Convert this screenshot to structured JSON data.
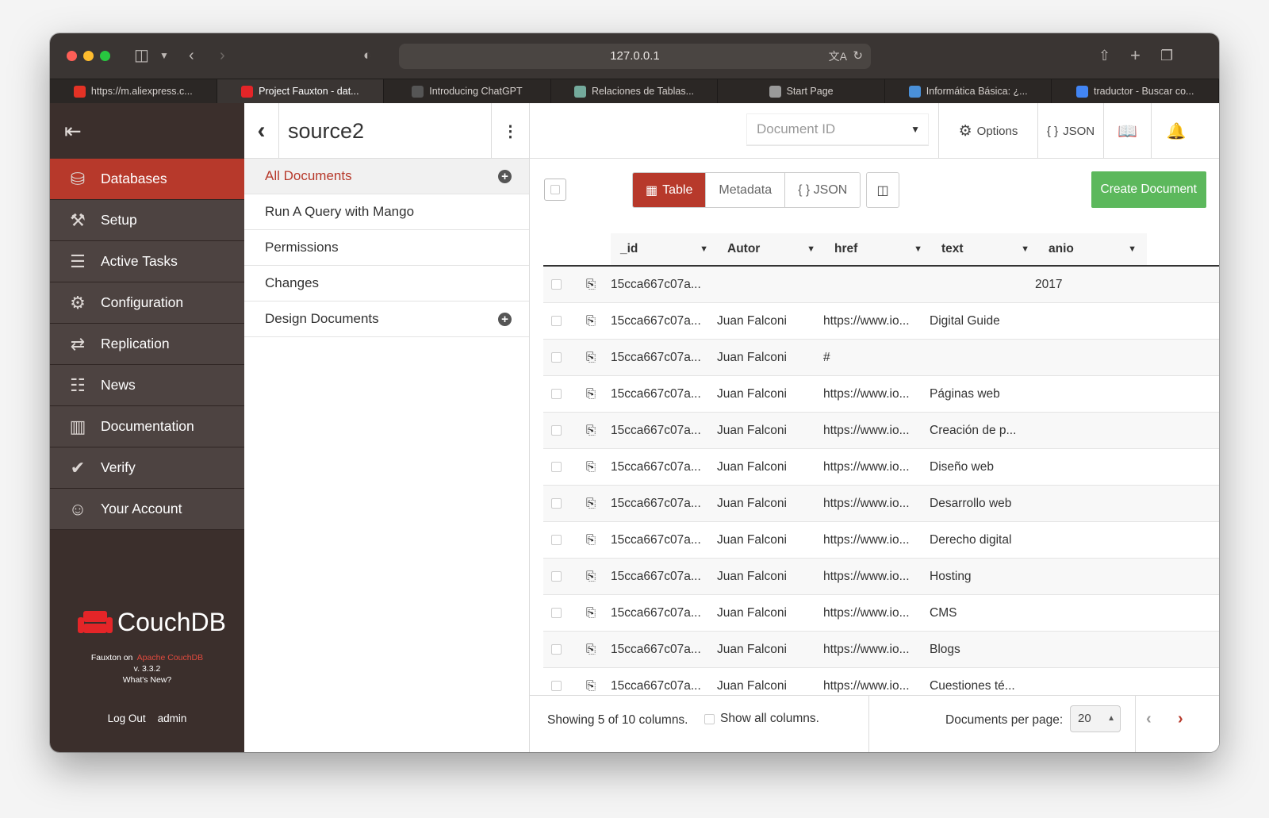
{
  "browser": {
    "url": "127.0.0.1",
    "tabs": [
      {
        "label": "https://m.aliexpress.c...",
        "favicon_color": "#e43225"
      },
      {
        "label": "Project Fauxton - dat...",
        "favicon_color": "#e42528",
        "active": true
      },
      {
        "label": "Introducing ChatGPT",
        "favicon_color": "#555555"
      },
      {
        "label": "Relaciones de Tablas...",
        "favicon_color": "#74aa9c"
      },
      {
        "label": "Start Page",
        "favicon_color": "#9a9a9a"
      },
      {
        "label": "Informática Básica: ¿...",
        "favicon_color": "#4a90d9"
      },
      {
        "label": "traductor - Buscar co...",
        "favicon_color": "#4285f4"
      }
    ]
  },
  "sidebar": {
    "items": [
      {
        "label": "Databases",
        "icon": "database-icon",
        "active": true
      },
      {
        "label": "Setup",
        "icon": "wrench-icon"
      },
      {
        "label": "Active Tasks",
        "icon": "tasks-icon"
      },
      {
        "label": "Configuration",
        "icon": "gear-icon"
      },
      {
        "label": "Replication",
        "icon": "replication-icon"
      },
      {
        "label": "News",
        "icon": "clipboard-icon"
      },
      {
        "label": "Documentation",
        "icon": "book-icon"
      },
      {
        "label": "Verify",
        "icon": "check-circle-icon"
      },
      {
        "label": "Your Account",
        "icon": "user-icon"
      }
    ],
    "brand": "CouchDB",
    "fauxton_on": "Fauxton on",
    "apache_couchdb": "Apache CouchDB",
    "version": "v. 3.3.2",
    "whats_new": "What's New?",
    "logout": "Log Out",
    "username": "admin"
  },
  "database": {
    "name": "source2",
    "nav": [
      {
        "label": "All Documents",
        "active": true,
        "has_add": true
      },
      {
        "label": "Run A Query with Mango"
      },
      {
        "label": "Permissions"
      },
      {
        "label": "Changes"
      },
      {
        "label": "Design Documents",
        "has_add": true
      }
    ]
  },
  "header": {
    "doc_id_placeholder": "Document ID",
    "options_label": "Options",
    "json_label": "JSON"
  },
  "toolbar": {
    "views": [
      "Table",
      "Metadata",
      "{ } JSON"
    ],
    "active_view": "Table",
    "create_label": "Create Document"
  },
  "table": {
    "columns": [
      "_id",
      "Autor",
      "href",
      "text",
      "anio"
    ],
    "rows": [
      [
        "15cca667c07a...",
        "",
        "",
        "",
        "2017"
      ],
      [
        "15cca667c07a...",
        "Juan Falconi",
        "https://www.io...",
        "Digital Guide",
        ""
      ],
      [
        "15cca667c07a...",
        "Juan Falconi",
        "#",
        "",
        ""
      ],
      [
        "15cca667c07a...",
        "Juan Falconi",
        "https://www.io...",
        "Páginas web",
        ""
      ],
      [
        "15cca667c07a...",
        "Juan Falconi",
        "https://www.io...",
        "Creación de p...",
        ""
      ],
      [
        "15cca667c07a...",
        "Juan Falconi",
        "https://www.io...",
        "Diseño web",
        ""
      ],
      [
        "15cca667c07a...",
        "Juan Falconi",
        "https://www.io...",
        "Desarrollo web",
        ""
      ],
      [
        "15cca667c07a...",
        "Juan Falconi",
        "https://www.io...",
        "Derecho digital",
        ""
      ],
      [
        "15cca667c07a...",
        "Juan Falconi",
        "https://www.io...",
        "Hosting",
        ""
      ],
      [
        "15cca667c07a...",
        "Juan Falconi",
        "https://www.io...",
        "CMS",
        ""
      ],
      [
        "15cca667c07a...",
        "Juan Falconi",
        "https://www.io...",
        "Blogs",
        ""
      ],
      [
        "15cca667c07a...",
        "Juan Falconi",
        "https://www.io...",
        "Cuestiones té...",
        ""
      ]
    ]
  },
  "footer": {
    "showing": "Showing 5 of 10 columns.",
    "show_all": "Show all columns.",
    "per_page_label": "Documents per page:",
    "per_page_value": "20"
  },
  "colors": {
    "accent": "#b7392b",
    "create": "#5cb85c",
    "sidebar": "#4d4341"
  }
}
